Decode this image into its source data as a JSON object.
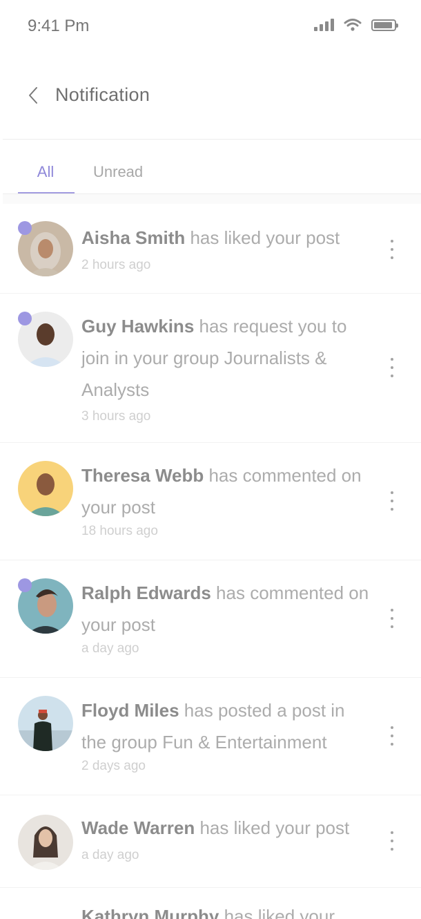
{
  "status_bar": {
    "time": "9:41 Pm",
    "icons": [
      "signal-icon",
      "wifi-icon",
      "battery-icon"
    ]
  },
  "header": {
    "back_icon": "chevron-left-icon",
    "title": "Notification"
  },
  "tabs": [
    {
      "label": "All",
      "active": true
    },
    {
      "label": "Unread",
      "active": false
    }
  ],
  "colors": {
    "accent": "#8f88d9",
    "unread_dot": "#9d97e2",
    "name": "#8c8c8c",
    "message": "#acacac",
    "time": "#cfcfcf"
  },
  "notifications": [
    {
      "name": "Aisha Smith",
      "message": " has liked your post",
      "time": "2 hours ago",
      "unread": true,
      "avatar_bg": "#c9b9a6"
    },
    {
      "name": "Guy Hawkins",
      "message": " has request you to join in your group Journalists & Analysts",
      "time": "3 hours ago",
      "unread": true,
      "avatar_bg": "#ececec"
    },
    {
      "name": "Theresa Webb",
      "message": " has commented on your post",
      "time": "18 hours ago",
      "unread": false,
      "avatar_bg": "#f8d37a"
    },
    {
      "name": "Ralph Edwards",
      "message": " has commented on your post",
      "time": "a day ago",
      "unread": true,
      "avatar_bg": "#7fb4be"
    },
    {
      "name": "Floyd Miles",
      "message": " has posted a post in the group Fun & Entertainment",
      "time": "2 days ago",
      "unread": false,
      "avatar_bg": "#cfe1ec"
    },
    {
      "name": "Wade Warren",
      "message": " has liked your post",
      "time": "a day ago",
      "unread": false,
      "avatar_bg": "#e8e4df"
    },
    {
      "name": "Kathryn Murphy",
      "message": " has liked your",
      "time": "",
      "unread": false,
      "avatar_bg": "#dddddd"
    }
  ]
}
